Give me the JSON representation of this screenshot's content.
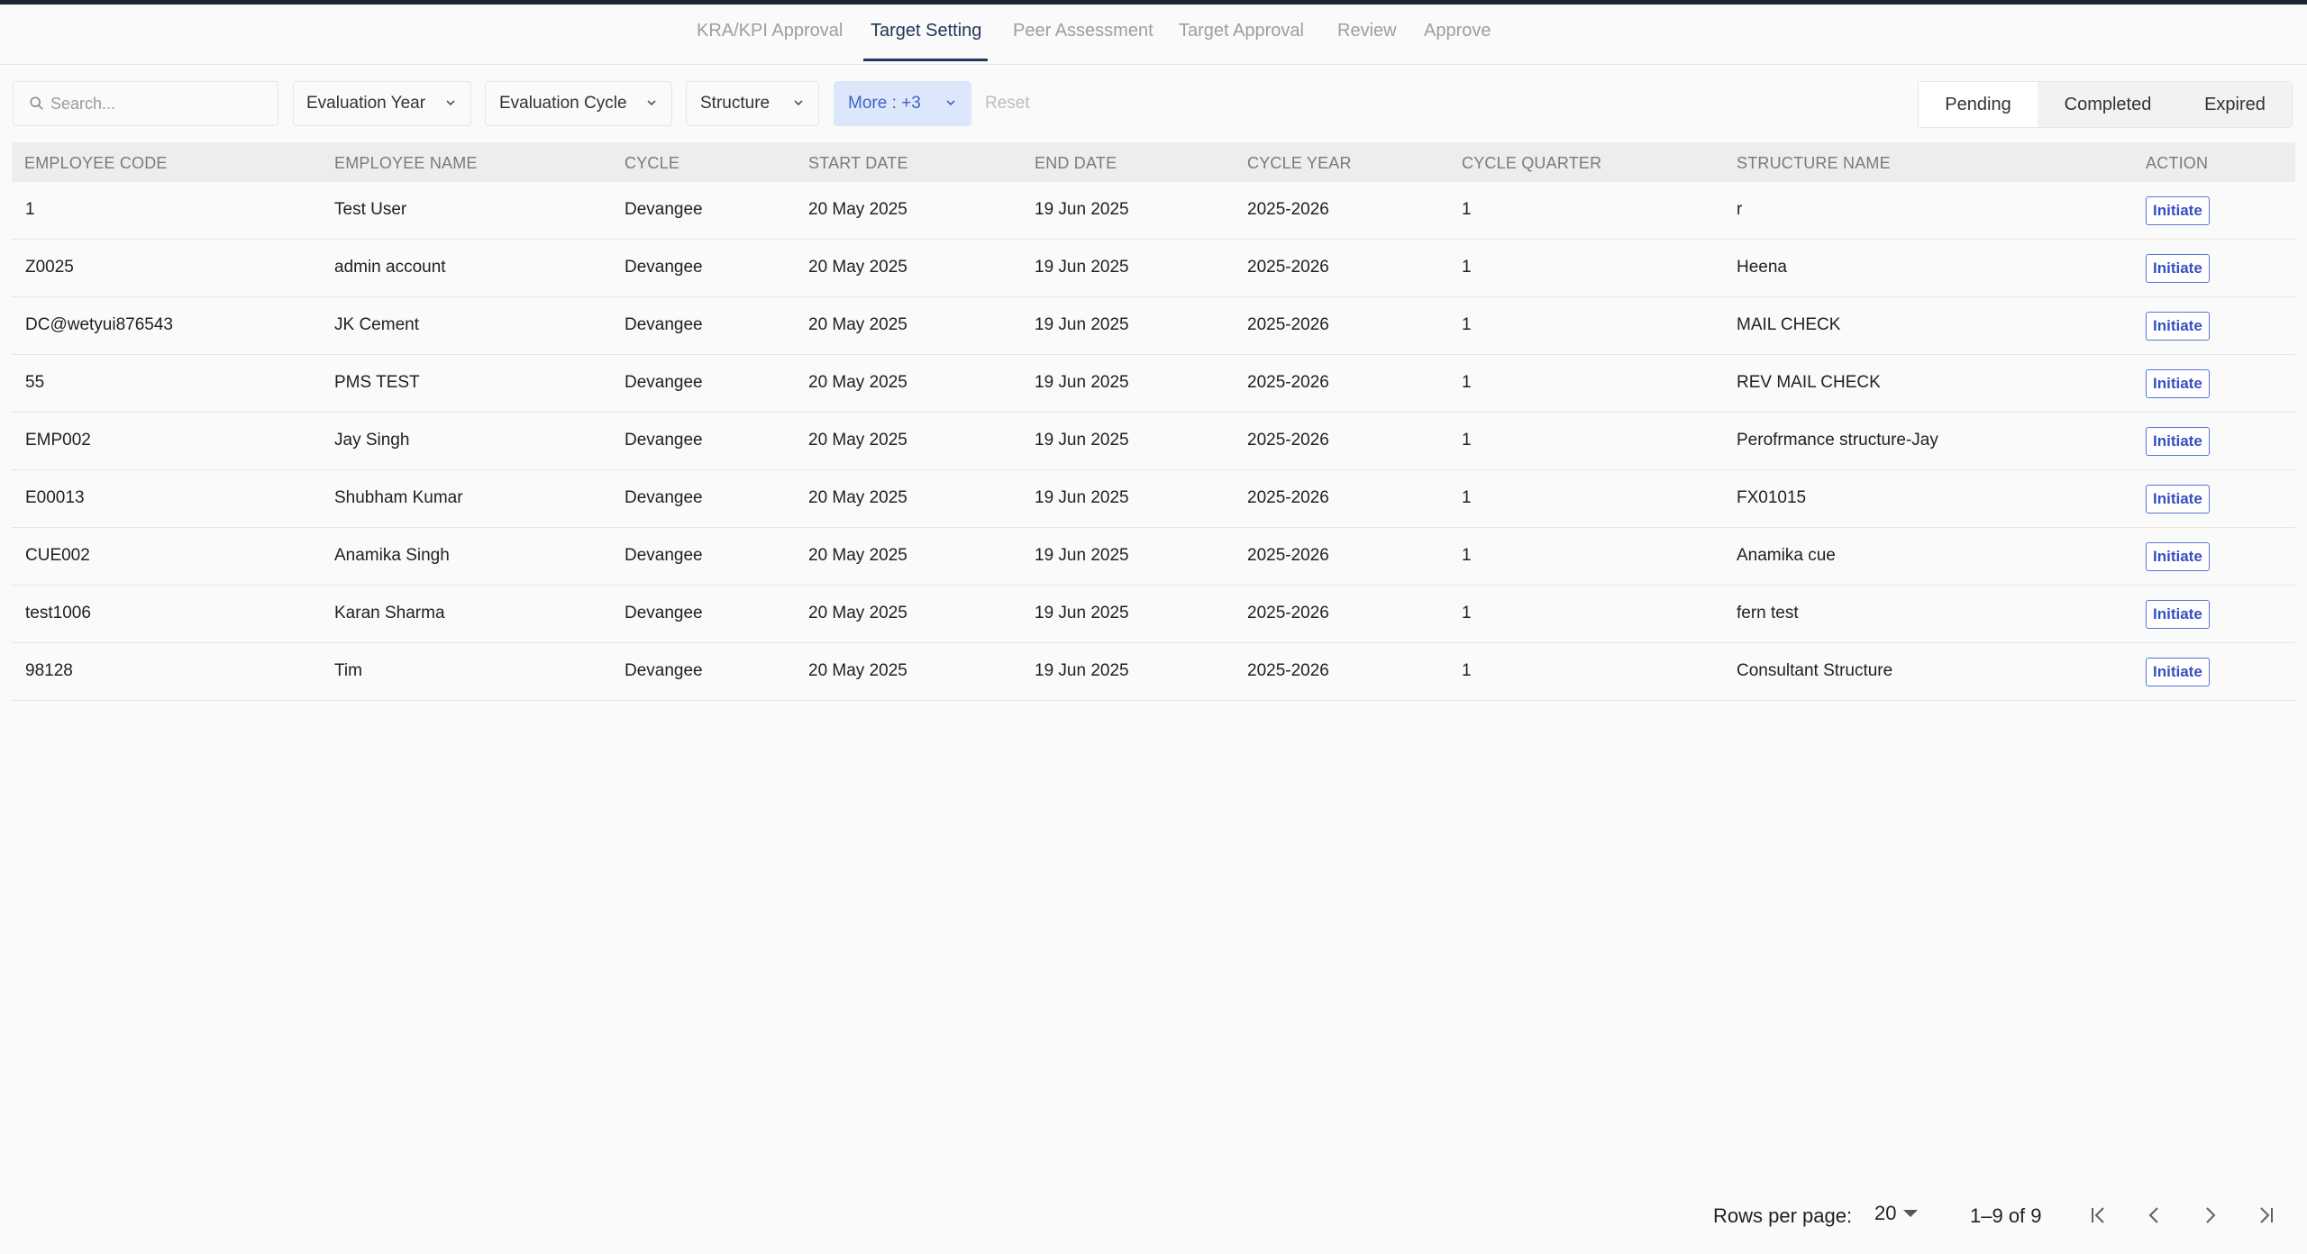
{
  "tabs": [
    {
      "label": "KRA/KPI Approval"
    },
    {
      "label": "Target Setting"
    },
    {
      "label": "Peer Assessment"
    },
    {
      "label": "Target Approval"
    },
    {
      "label": "Review"
    },
    {
      "label": "Approve"
    }
  ],
  "active_tab": "Target Setting",
  "filters": {
    "search_placeholder": "Search...",
    "evaluation_year": "Evaluation Year",
    "evaluation_cycle": "Evaluation Cycle",
    "structure": "Structure",
    "more": "More : +3",
    "reset": "Reset"
  },
  "status": {
    "pending": "Pending",
    "completed": "Completed",
    "expired": "Expired",
    "active": "Pending"
  },
  "table": {
    "headers": [
      "EMPLOYEE CODE",
      "EMPLOYEE NAME",
      "CYCLE",
      "START DATE",
      "END DATE",
      "CYCLE YEAR",
      "CYCLE QUARTER",
      "STRUCTURE NAME",
      "ACTION"
    ],
    "action_label": "Initiate",
    "rows": [
      [
        "1",
        "Test User",
        "Devangee",
        "20 May 2025",
        "19 Jun 2025",
        "2025-2026",
        "1",
        "r"
      ],
      [
        "Z0025",
        "admin account",
        "Devangee",
        "20 May 2025",
        "19 Jun 2025",
        "2025-2026",
        "1",
        "Heena"
      ],
      [
        "DC@wetyui876543",
        "JK Cement",
        "Devangee",
        "20 May 2025",
        "19 Jun 2025",
        "2025-2026",
        "1",
        "MAIL CHECK"
      ],
      [
        "55",
        "PMS TEST",
        "Devangee",
        "20 May 2025",
        "19 Jun 2025",
        "2025-2026",
        "1",
        "REV MAIL CHECK"
      ],
      [
        "EMP002",
        "Jay Singh",
        "Devangee",
        "20 May 2025",
        "19 Jun 2025",
        "2025-2026",
        "1",
        "Perofrmance structure-Jay"
      ],
      [
        "E00013",
        "Shubham Kumar",
        "Devangee",
        "20 May 2025",
        "19 Jun 2025",
        "2025-2026",
        "1",
        "FX01015"
      ],
      [
        "CUE002",
        "Anamika Singh",
        "Devangee",
        "20 May 2025",
        "19 Jun 2025",
        "2025-2026",
        "1",
        "Anamika cue"
      ],
      [
        "test1006",
        "Karan Sharma",
        "Devangee",
        "20 May 2025",
        "19 Jun 2025",
        "2025-2026",
        "1",
        "fern test"
      ],
      [
        "98128",
        "Tim",
        "Devangee",
        "20 May 2025",
        "19 Jun 2025",
        "2025-2026",
        "1",
        "Consultant Structure"
      ]
    ]
  },
  "pagination": {
    "rows_per_page_label": "Rows per page:",
    "rows_per_page": "20",
    "range": "1–9 of 9"
  },
  "icons": {
    "search": "search-icon",
    "chevron": "chevron-down-icon",
    "first": "first-page-icon",
    "prev": "previous-page-icon",
    "next": "next-page-icon",
    "last": "last-page-icon"
  },
  "colors": {
    "accent": "#223a5c",
    "more_bg": "#dde7fb",
    "action_border": "#5b73d6"
  }
}
